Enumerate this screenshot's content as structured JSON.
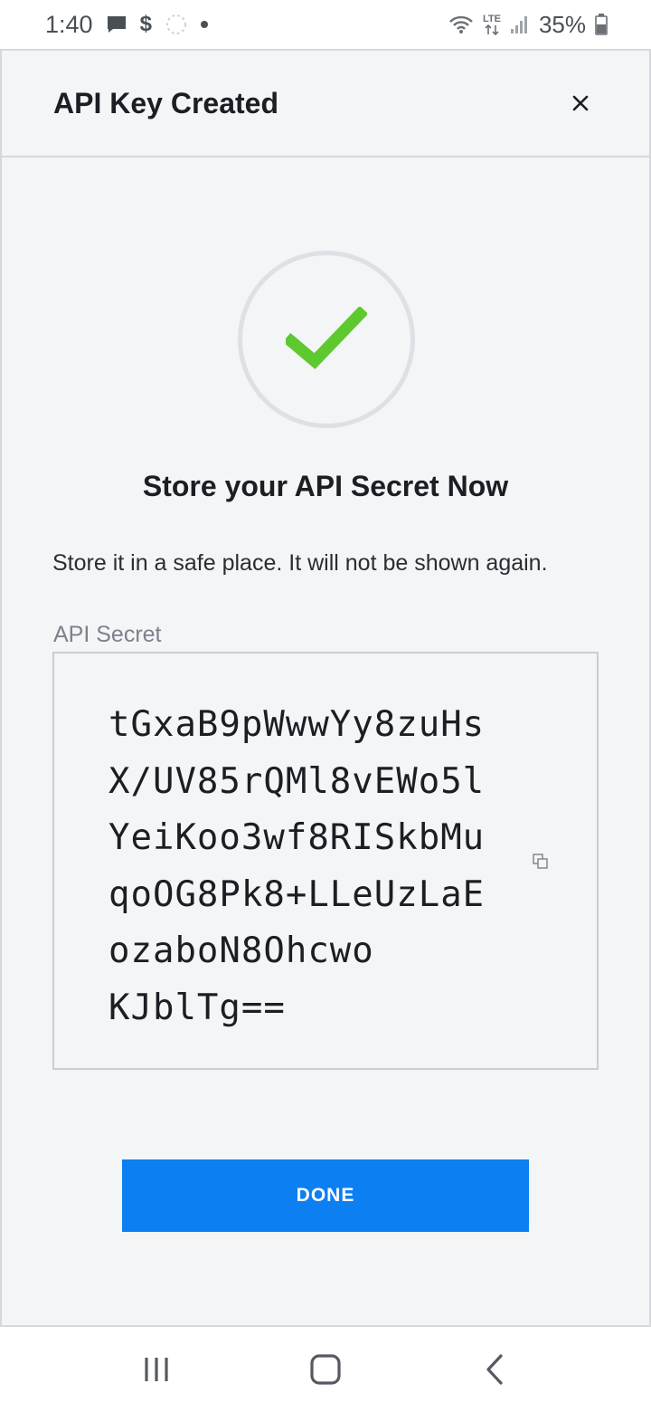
{
  "status_bar": {
    "time": "1:40",
    "network": "LTE",
    "battery": "35%"
  },
  "dialog": {
    "title": "API Key Created",
    "close_icon": "close-icon",
    "success_icon": "checkmark-icon",
    "heading": "Store your API Secret Now",
    "note": "Store it in a safe place. It will not be shown again.",
    "secret_label": "API Secret",
    "secret_value": "tGxaB9pWwwYy8zuHsX/UV85rQMl8vEWo5lYeiKoo3wf8RISkbMuqoOG8Pk8+LLeUzLaEozaboN8Ohcwo\nKJblTg==",
    "copy_icon": "copy-icon",
    "done_label": "DONE"
  },
  "colors": {
    "primary": "#0c7ff2",
    "success": "#5ec92e",
    "background": "#f3f5f7",
    "border": "#d5d9de"
  },
  "nav_bar": {
    "icons": [
      "recent-apps-icon",
      "home-icon",
      "back-icon"
    ]
  }
}
